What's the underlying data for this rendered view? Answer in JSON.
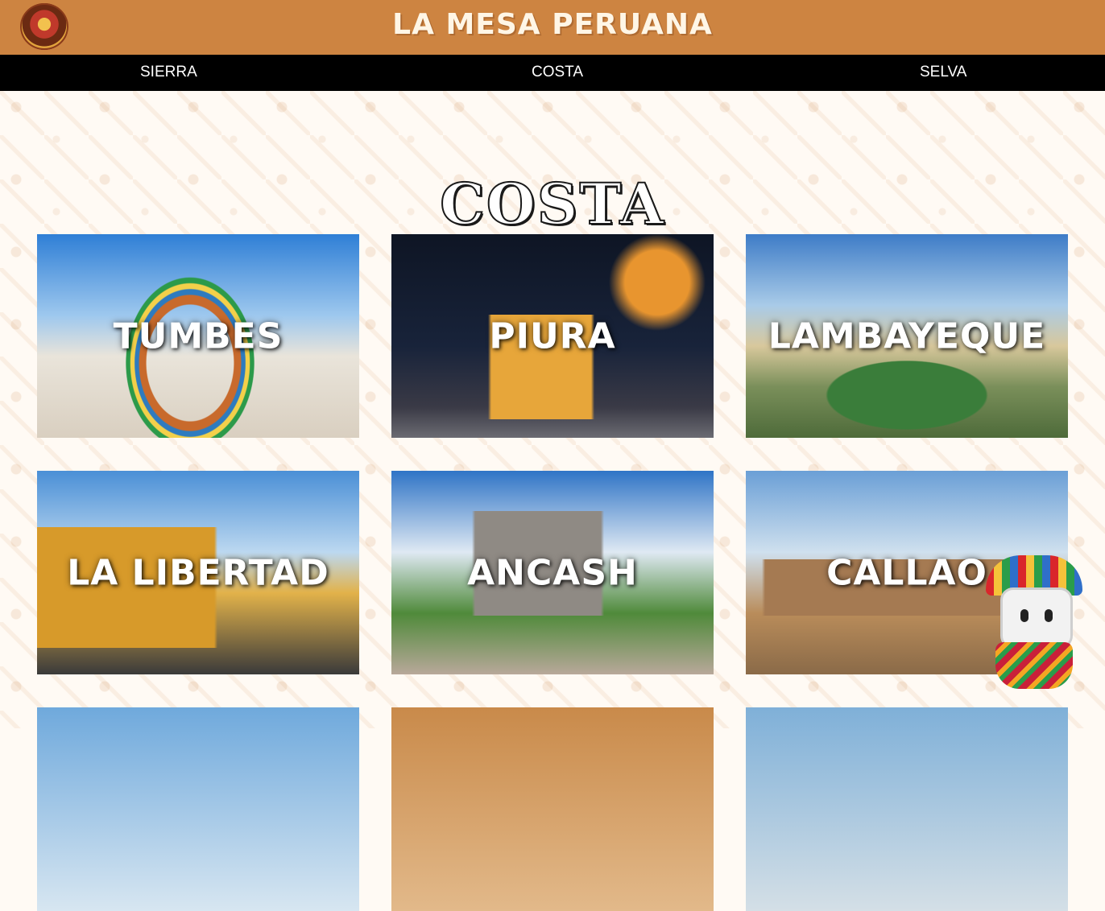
{
  "header": {
    "title": "LA MESA PERUANA",
    "logo": "restaurant-logo"
  },
  "nav": {
    "items": [
      {
        "label": "SIERRA"
      },
      {
        "label": "COSTA"
      },
      {
        "label": "SELVA"
      }
    ]
  },
  "main": {
    "heading": "COSTA",
    "cards": [
      {
        "label": "TUMBES"
      },
      {
        "label": "PIURA"
      },
      {
        "label": "LAMBAYEQUE"
      },
      {
        "label": "LA LIBERTAD"
      },
      {
        "label": "ANCASH"
      },
      {
        "label": "CALLAO"
      },
      {
        "label": ""
      },
      {
        "label": ""
      },
      {
        "label": ""
      }
    ]
  },
  "colors": {
    "header_bg": "#cd8441",
    "nav_bg": "#000000",
    "page_bg": "#fffaf4"
  },
  "mascot": {
    "icon": "chat-mascot-icon"
  }
}
